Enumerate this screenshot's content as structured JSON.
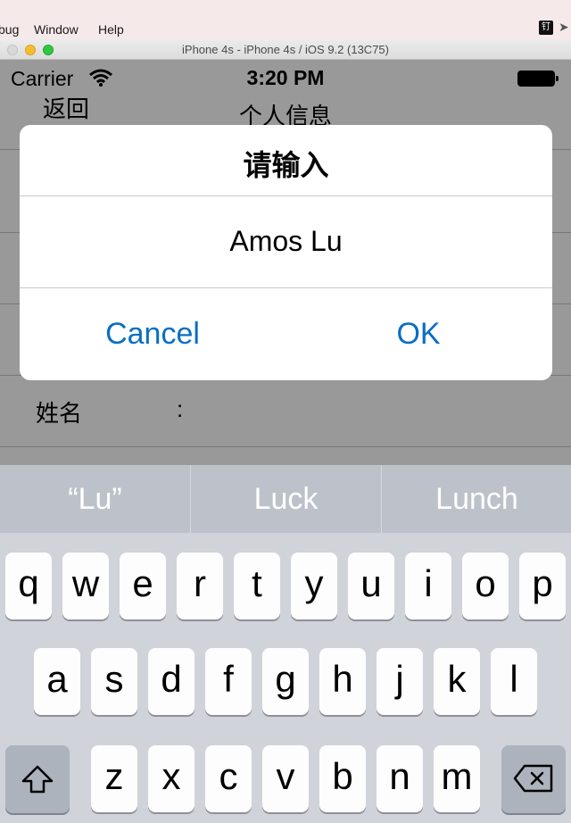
{
  "mac_menu": {
    "items": [
      "bug",
      "Window",
      "Help"
    ],
    "badge": "钉"
  },
  "simulator": {
    "title": "iPhone 4s - iPhone 4s / iOS 9.2 (13C75)"
  },
  "status_bar": {
    "carrier": "Carrier",
    "time": "3:20 PM"
  },
  "nav": {
    "back_label": "返回",
    "title": "个人信息"
  },
  "form": {
    "name_label": "姓名",
    "colon": ":"
  },
  "alert": {
    "title": "请输入",
    "input_value": "Amos Lu",
    "cancel_label": "Cancel",
    "ok_label": "OK",
    "button_color": "#0a6ec4"
  },
  "keyboard": {
    "suggestions": [
      "“Lu”",
      "Luck",
      "Lunch"
    ],
    "row1": [
      "q",
      "w",
      "e",
      "r",
      "t",
      "y",
      "u",
      "i",
      "o",
      "p"
    ],
    "row2": [
      "a",
      "s",
      "d",
      "f",
      "g",
      "h",
      "j",
      "k",
      "l"
    ],
    "row3": [
      "z",
      "x",
      "c",
      "v",
      "b",
      "n",
      "m"
    ],
    "shift_icon": "shift-icon",
    "delete_icon": "delete-icon"
  }
}
